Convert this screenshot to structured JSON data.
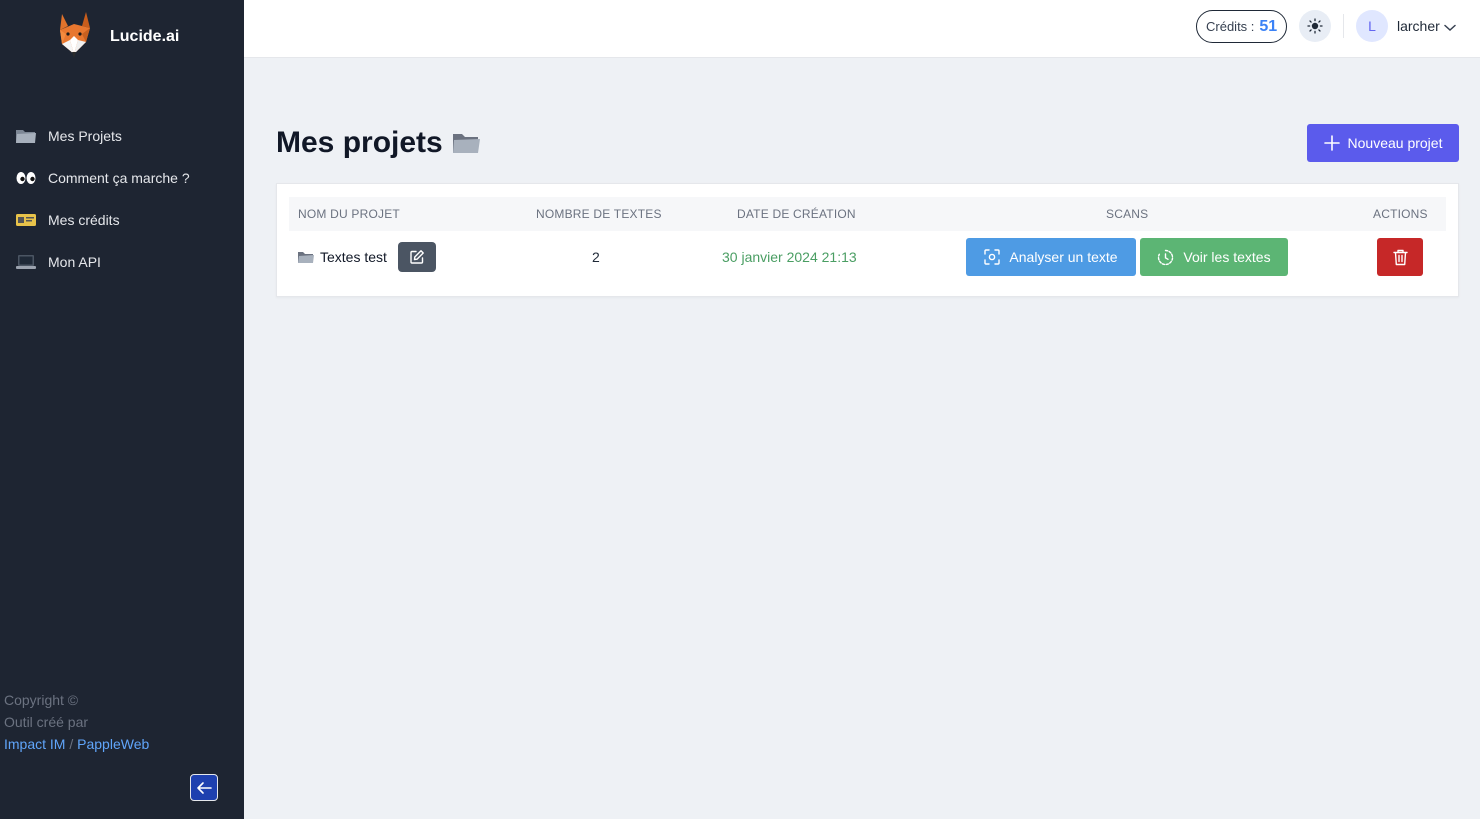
{
  "app": {
    "name": "Lucide.ai"
  },
  "sidebar": {
    "items": [
      {
        "icon": "folder-icon",
        "label": "Mes Projets"
      },
      {
        "icon": "eyes-icon",
        "label": "Comment ça marche ?"
      },
      {
        "icon": "id-card-icon",
        "label": "Mes crédits"
      },
      {
        "icon": "laptop-icon",
        "label": "Mon API"
      }
    ],
    "footer": {
      "line1": "Copyright ©",
      "line2": "Outil créé par",
      "link1": "Impact IM",
      "separator": "/",
      "link2": "PappleWeb"
    }
  },
  "header": {
    "credits_label": "Crédits :",
    "credits_value": "51",
    "user_initial": "L",
    "user_name": "larcher"
  },
  "main": {
    "title": "Mes projets",
    "new_button": "Nouveau projet",
    "table": {
      "columns": [
        "NOM DU PROJET",
        "NOMBRE DE TEXTES",
        "DATE DE CRÉATION",
        "SCANS",
        "ACTIONS"
      ],
      "rows": [
        {
          "name": "Textes test",
          "count": "2",
          "date": "30 janvier 2024 21:13",
          "scan_analyse": "Analyser un texte",
          "scan_voir": "Voir les textes"
        }
      ]
    }
  },
  "colors": {
    "sidebar_bg": "#1e2532",
    "accent": "#5b5bec",
    "analyse": "#4e9be4",
    "voir": "#5cb574",
    "delete": "#c62828",
    "date": "#4a9e63",
    "credits": "#3b82f6"
  }
}
